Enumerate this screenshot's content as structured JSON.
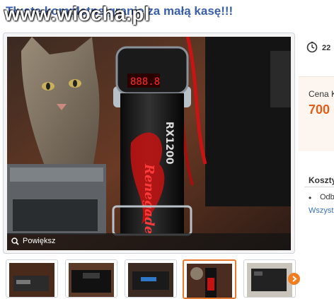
{
  "title": "Tłuste kompletne granie za małą kasę!!!",
  "watermark": "www.wiocha.pl",
  "gallery": {
    "zoom_label": "Powiększ",
    "main_photo_icon": "zoom-icon",
    "capacitor_display": "888.8",
    "capacitor_model": "RX1200",
    "capacitor_brand": "Renegade",
    "thumbnails": [
      "thumb-radio",
      "thumb-amplifier",
      "thumb-headunit",
      "thumb-capacitor",
      "thumb-amp-box"
    ],
    "selected_thumbnail": 3,
    "next_icon": "chevron-right-icon"
  },
  "sidebar": {
    "time_text": "22",
    "price_label": "Cena K",
    "price_value": "700",
    "costs_title": "Koszty",
    "delivery_option": "Odb",
    "all_link": "Wszyst"
  },
  "colors": {
    "title": "#3b5eac",
    "price": "#e25d17",
    "accent": "#f07d1f",
    "link": "#3b6fb8"
  }
}
